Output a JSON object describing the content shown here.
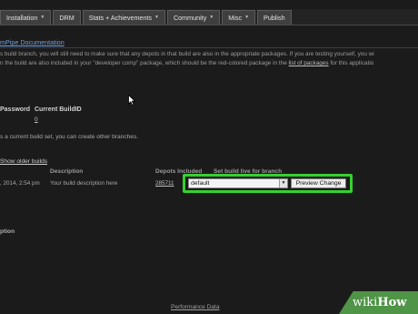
{
  "nav": {
    "tabs": [
      {
        "label": "Installation",
        "dropdown": true
      },
      {
        "label": "DRM",
        "dropdown": false
      },
      {
        "label": "Stats + Achievements",
        "dropdown": true
      },
      {
        "label": "Community",
        "dropdown": true
      },
      {
        "label": "Misc",
        "dropdown": true
      },
      {
        "label": "Publish",
        "dropdown": false
      }
    ]
  },
  "section": {
    "title": "mPipe Documentation",
    "para1": "s build branch, you will still need to make sure that any depots in that build are also in the appropriate packages. If you are testing yourself, you wi",
    "para2_pre": "n the build are also included in your \"developer comp\" package, which should be the red-colored package in the ",
    "para2_link": "list of packages",
    "para2_post": " for this applicatio"
  },
  "branches_table": {
    "headers": [
      "Password",
      "Current BuildID"
    ],
    "values": [
      "0"
    ]
  },
  "branch_note": "s a current build set, you can create other branches.",
  "show_older": "Show older builds",
  "builds_table": {
    "headers": [
      "Description",
      "Depots Included",
      "Set build live for branch"
    ],
    "row": {
      "date": ", 2014, 2:54 pm",
      "description": "Your build description here",
      "depot": "285711",
      "branch_selected": "default",
      "preview_label": "Preview Change"
    }
  },
  "left_label": "ption",
  "footer": {
    "link": "Performance Data"
  },
  "watermark": {
    "wiki": "wiki",
    "how": "How"
  },
  "colors": {
    "highlight": "#35d12c",
    "link": "#6fa0d8",
    "watermark_bg": "#4f9447"
  }
}
